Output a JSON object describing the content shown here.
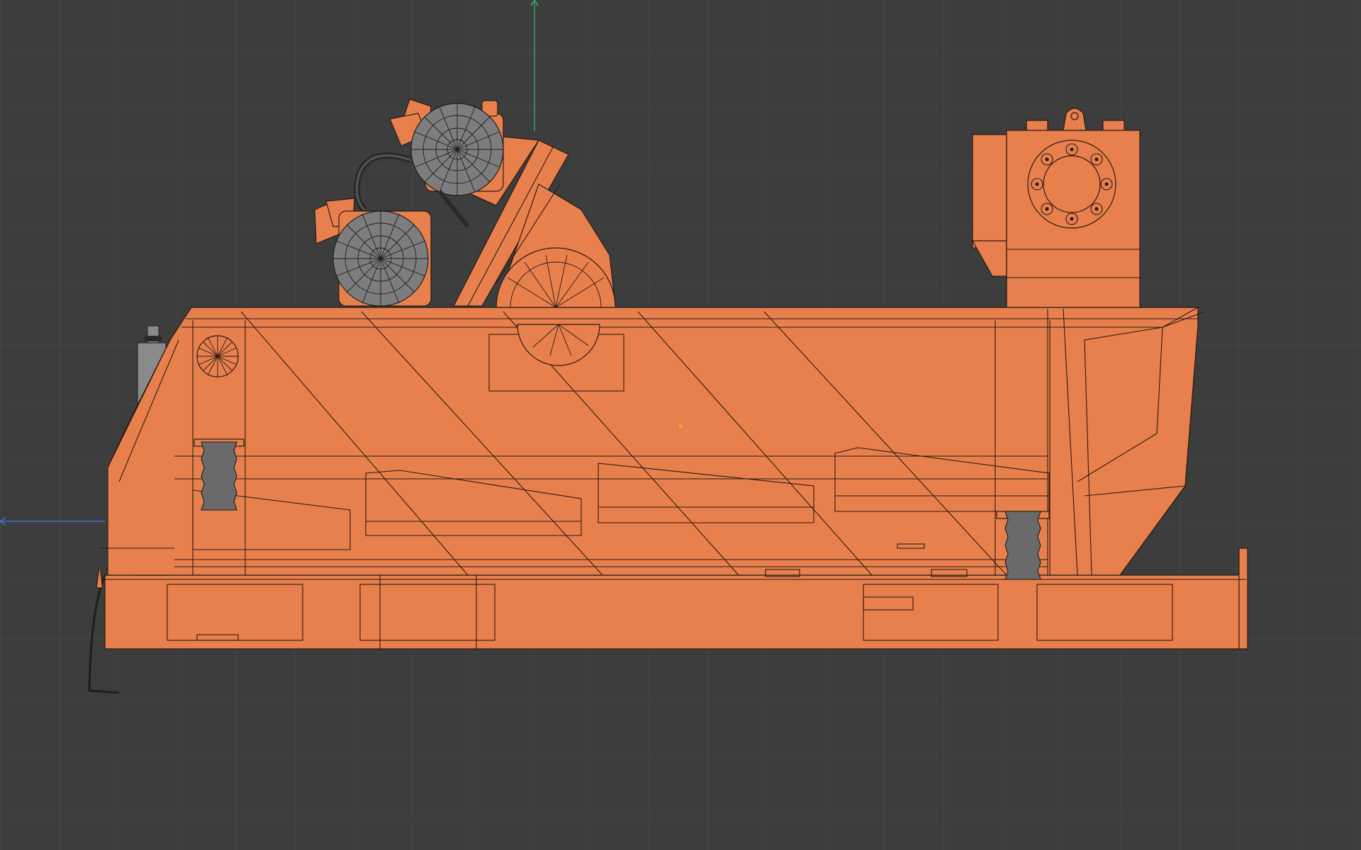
{
  "viewport": {
    "background": "#3d3d3d",
    "grid_color": "#4b4b4b",
    "object_color": "#e8804e",
    "edge_color": "#2a1a12",
    "y_axis_color": "#3aa86b",
    "x_axis_color": "#3a73c9",
    "origin_color": "#ff9a2e"
  },
  "object": {
    "type": "shale shaker (side orthographic view)",
    "motors": [
      "vibrator-motor-upper",
      "vibrator-motor-lower"
    ],
    "icons": [
      "y-axis-arrow-icon",
      "x-axis-arrow-icon",
      "origin-dot-icon"
    ]
  }
}
